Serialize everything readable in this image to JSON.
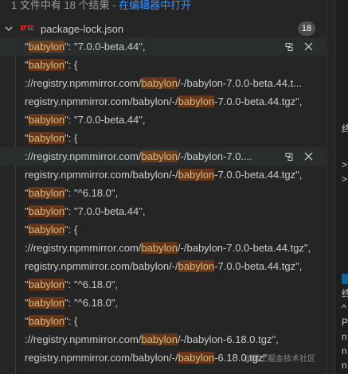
{
  "summary": {
    "text": "1 文件中有 18 个结果 - ",
    "link": "在编辑器中打开"
  },
  "file": {
    "name": "package-lock.json",
    "icon": "npm-icon",
    "count": "18"
  },
  "matches": [
    {
      "parts": [
        {
          "t": "\""
        },
        {
          "t": "babylon",
          "h": true
        },
        {
          "t": "\": \"7.0.0-beta.44\","
        }
      ],
      "hover": true
    },
    {
      "parts": [
        {
          "t": "\""
        },
        {
          "t": "babylon",
          "h": true
        },
        {
          "t": "\": {"
        }
      ]
    },
    {
      "parts": [
        {
          "t": "://registry.npmmirror.com/"
        },
        {
          "t": "babylon",
          "h": true
        },
        {
          "t": "/-/babylon-7.0.0-beta.44.t..."
        }
      ]
    },
    {
      "parts": [
        {
          "t": "registry.npmmirror.com/babylon/-/"
        },
        {
          "t": "babylon",
          "h": true
        },
        {
          "t": "-7.0.0-beta.44.tgz\","
        }
      ]
    },
    {
      "parts": [
        {
          "t": "\""
        },
        {
          "t": "babylon",
          "h": true
        },
        {
          "t": "\": \"7.0.0-beta.44\","
        }
      ]
    },
    {
      "parts": [
        {
          "t": "\""
        },
        {
          "t": "babylon",
          "h": true
        },
        {
          "t": "\": {"
        }
      ]
    },
    {
      "parts": [
        {
          "t": "://registry.npmmirror.com/"
        },
        {
          "t": "babylon",
          "h": true
        },
        {
          "t": "/-/babylon-7.0...."
        }
      ],
      "hover": true
    },
    {
      "parts": [
        {
          "t": "registry.npmmirror.com/babylon/-/"
        },
        {
          "t": "babylon",
          "h": true
        },
        {
          "t": "-7.0.0-beta.44.tgz\","
        }
      ]
    },
    {
      "parts": [
        {
          "t": "\""
        },
        {
          "t": "babylon",
          "h": true
        },
        {
          "t": "\": \"^6.18.0\","
        }
      ]
    },
    {
      "parts": [
        {
          "t": "\""
        },
        {
          "t": "babylon",
          "h": true
        },
        {
          "t": "\": \"7.0.0-beta.44\","
        }
      ]
    },
    {
      "parts": [
        {
          "t": "\""
        },
        {
          "t": "babylon",
          "h": true
        },
        {
          "t": "\": {"
        }
      ]
    },
    {
      "parts": [
        {
          "t": "://registry.npmmirror.com/"
        },
        {
          "t": "babylon",
          "h": true
        },
        {
          "t": "/-/babylon-7.0.0-beta.44.tgz\","
        }
      ]
    },
    {
      "parts": [
        {
          "t": "registry.npmmirror.com/babylon/-/"
        },
        {
          "t": "babylon",
          "h": true
        },
        {
          "t": "-7.0.0-beta.44.tgz\","
        }
      ]
    },
    {
      "parts": [
        {
          "t": "\""
        },
        {
          "t": "babylon",
          "h": true
        },
        {
          "t": "\": \"^6.18.0\","
        }
      ]
    },
    {
      "parts": [
        {
          "t": "\""
        },
        {
          "t": "babylon",
          "h": true
        },
        {
          "t": "\": \"^6.18.0\","
        }
      ]
    },
    {
      "parts": [
        {
          "t": "\""
        },
        {
          "t": "babylon",
          "h": true
        },
        {
          "t": "\": {"
        }
      ]
    },
    {
      "parts": [
        {
          "t": "://registry.npmmirror.com/"
        },
        {
          "t": "babylon",
          "h": true
        },
        {
          "t": "/-/babylon-6.18.0.tgz\","
        }
      ]
    },
    {
      "parts": [
        {
          "t": "registry.npmmirror.com/babylon/-/"
        },
        {
          "t": "babylon",
          "h": true
        },
        {
          "t": "-6.18.0.tgz\""
        }
      ]
    }
  ],
  "right_pane": {
    "lines": [
      "终",
      ">",
      ">",
      "终",
      "^",
      "P",
      "n",
      "n",
      "n"
    ]
  },
  "watermark": "@稀土掘金技术社区",
  "colors": {
    "background": "#252526",
    "highlight": "#ea5c00",
    "link": "#3794ff",
    "npm_red": "#cb3837"
  }
}
